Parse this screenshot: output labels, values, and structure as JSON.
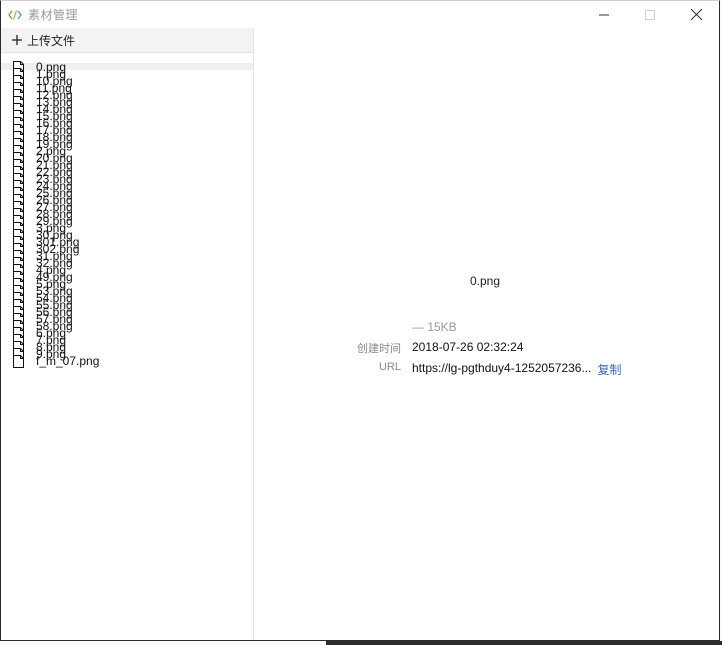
{
  "window": {
    "title": "素材管理",
    "icon": "code-icon",
    "accent": "#3cb371"
  },
  "toolbar": {
    "upload_label": "上传文件"
  },
  "files": [
    "0.png",
    "1.png",
    "10.png",
    "11.png",
    "12.png",
    "13.png",
    "14.png",
    "15.png",
    "16.png",
    "17.png",
    "18.png",
    "19.png",
    "2.png",
    "20.png",
    "21.png",
    "22.png",
    "23.png",
    "24.png",
    "25.png",
    "26.png",
    "27.png",
    "28.png",
    "29.png",
    "3.png",
    "30.png",
    "301.png",
    "302.png",
    "31.png",
    "32.png",
    "4.png",
    "49.png",
    "5.png",
    "53.png",
    "54.png",
    "55.png",
    "56.png",
    "57.png",
    "58.png",
    "6.png",
    "7.png",
    "8.png",
    "9.png",
    "f_m_07.png"
  ],
  "selected_index": 0,
  "preview": {
    "name": "0.png",
    "size": "— 15KB",
    "created_label": "创建时间",
    "created_value": "2018-07-26 02:32:24",
    "url_label": "URL",
    "url_value": "https://lg-pgthduy4-1252057236...",
    "copy_label": "复制"
  }
}
